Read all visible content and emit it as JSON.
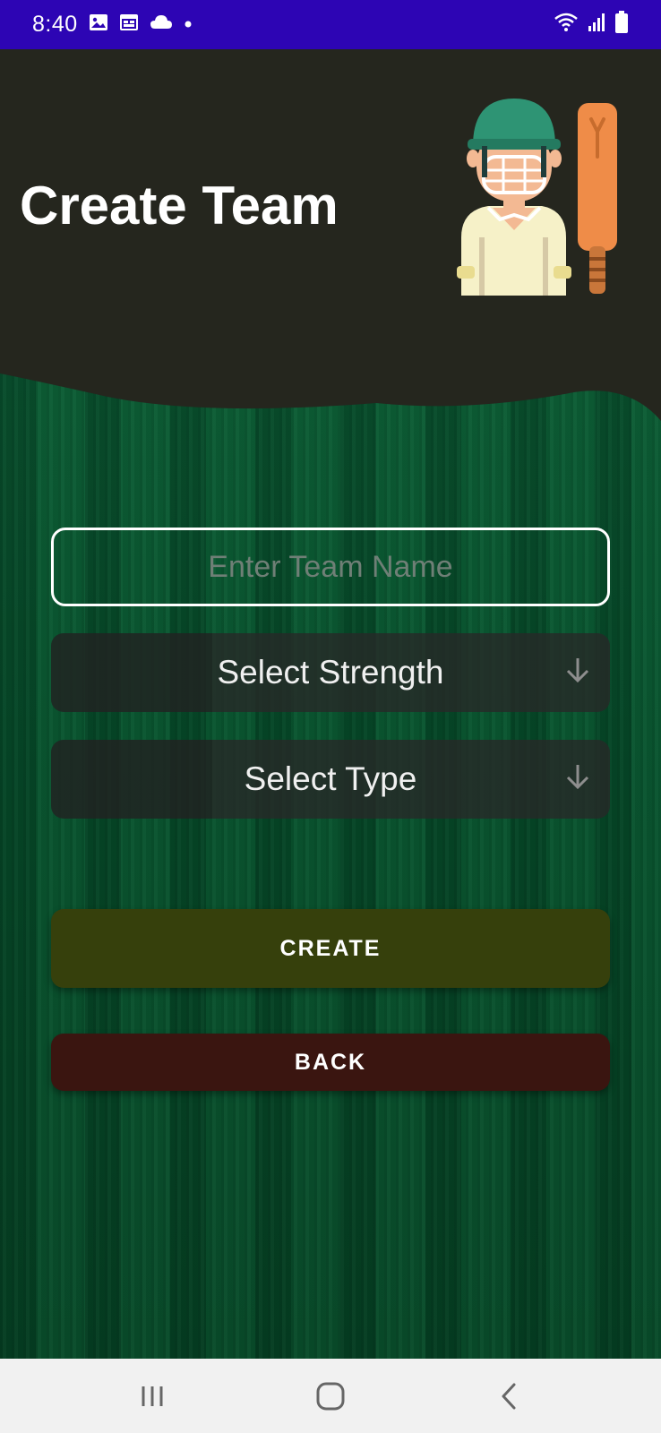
{
  "status_bar": {
    "time": "8:40",
    "left_icons": [
      "image-icon",
      "calendar-icon",
      "cloud-icon",
      "dot-icon"
    ],
    "right_icons": [
      "wifi-icon",
      "signal-icon",
      "battery-icon"
    ]
  },
  "header": {
    "title": "Create Team",
    "illustration": "cricket-player-with-bat"
  },
  "form": {
    "team_name_placeholder": "Enter Team Name",
    "team_name_value": "",
    "strength_select": "Select Strength",
    "type_select": "Select Type"
  },
  "buttons": {
    "create": "CREATE",
    "back": "BACK"
  },
  "colors": {
    "status_bar": "#2d05b4",
    "header_bg": "#25261e",
    "field_bg": "#063a22",
    "create_button": "#36400c",
    "back_button": "#3a1510"
  },
  "nav": {
    "recents": "recents-icon",
    "home": "home-icon",
    "back": "back-icon"
  }
}
